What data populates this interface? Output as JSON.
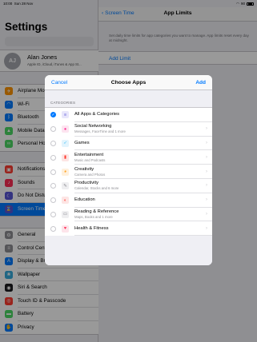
{
  "status_bar": {
    "time": "10:00",
    "date": "Sun 28 Nov",
    "battery": "90"
  },
  "sidebar": {
    "title": "Settings",
    "profile": {
      "initials": "AJ",
      "name": "Alan Jones",
      "subtitle": "Apple ID, iCloud, iTunes & App St..."
    },
    "groups": [
      [
        {
          "label": "Airplane Mode",
          "icon": "airplane-icon",
          "color": "#ff9500",
          "glyph": "✈"
        },
        {
          "label": "Wi-Fi",
          "icon": "wifi-icon",
          "color": "#007aff",
          "glyph": "◠"
        },
        {
          "label": "Bluetooth",
          "icon": "bluetooth-icon",
          "color": "#007aff",
          "glyph": "ᛒ"
        },
        {
          "label": "Mobile Data",
          "icon": "antenna-icon",
          "color": "#4cd964",
          "glyph": "▲"
        },
        {
          "label": "Personal Hotspot",
          "icon": "hotspot-icon",
          "color": "#4cd964",
          "glyph": "∞"
        }
      ],
      [
        {
          "label": "Notifications",
          "icon": "notifications-icon",
          "color": "#ff3b30",
          "glyph": "▣"
        },
        {
          "label": "Sounds",
          "icon": "speaker-icon",
          "color": "#ff2d55",
          "glyph": "♪"
        },
        {
          "label": "Do Not Disturb",
          "icon": "moon-icon",
          "color": "#5856d6",
          "glyph": "☾"
        },
        {
          "label": "Screen Time",
          "icon": "hourglass-icon",
          "color": "#5856d6",
          "glyph": "⌛",
          "selected": true
        }
      ],
      [
        {
          "label": "General",
          "icon": "gear-icon",
          "color": "#8e8e93",
          "glyph": "⚙"
        },
        {
          "label": "Control Centre",
          "icon": "switches-icon",
          "color": "#8e8e93",
          "glyph": "≡"
        },
        {
          "label": "Display & Brightness",
          "icon": "text-size-icon",
          "color": "#007aff",
          "glyph": "A"
        },
        {
          "label": "Wallpaper",
          "icon": "wallpaper-icon",
          "color": "#34aadc",
          "glyph": "❀"
        },
        {
          "label": "Siri & Search",
          "icon": "siri-icon",
          "color": "#1c1c1e",
          "glyph": "◉"
        },
        {
          "label": "Touch ID & Passcode",
          "icon": "fingerprint-icon",
          "color": "#ff3b30",
          "glyph": "◎"
        },
        {
          "label": "Battery",
          "icon": "battery-icon",
          "color": "#4cd964",
          "glyph": "▬"
        },
        {
          "label": "Privacy",
          "icon": "hand-icon",
          "color": "#007aff",
          "glyph": "✋"
        }
      ]
    ]
  },
  "detail": {
    "back_label": "Screen Time",
    "title": "App Limits",
    "footnote": "Set daily time limits for app categories you want to manage. App limits reset every day at midnight.",
    "add_limit": "Add Limit"
  },
  "modal": {
    "cancel": "Cancel",
    "title": "Choose Apps",
    "add": "Add",
    "section": "CATEGORIES",
    "items": [
      {
        "title": "All Apps & Categories",
        "subtitle": "",
        "icon": "stack-icon",
        "color": "#5856d6",
        "bg": "#e8e6fb",
        "glyph": "≡",
        "checked": true
      },
      {
        "title": "Social Networking",
        "subtitle": "Messages, FaceTime and 1 more",
        "icon": "speech-bubble-icon",
        "color": "#ff2d95",
        "bg": "#fde4f0",
        "glyph": "●"
      },
      {
        "title": "Games",
        "subtitle": "",
        "icon": "rocket-icon",
        "color": "#5ac8fa",
        "bg": "#e2f4fd",
        "glyph": "➶"
      },
      {
        "title": "Entertainment",
        "subtitle": "Music and Podcasts",
        "icon": "popcorn-icon",
        "color": "#ff3b30",
        "bg": "#fde5e4",
        "glyph": "▮"
      },
      {
        "title": "Creativity",
        "subtitle": "Camera and Photos",
        "icon": "palette-icon",
        "color": "#ff9500",
        "bg": "#fff0dc",
        "glyph": "◕"
      },
      {
        "title": "Productivity",
        "subtitle": "Calendar, Stocks and 6 more",
        "icon": "pencil-icon",
        "color": "#8e8e93",
        "bg": "#eeeef0",
        "glyph": "✎"
      },
      {
        "title": "Education",
        "subtitle": "",
        "icon": "globe-icon",
        "color": "#ff3b30",
        "bg": "#fde5e4",
        "glyph": "◐"
      },
      {
        "title": "Reading & Reference",
        "subtitle": "Maps, Books and 1 more",
        "icon": "book-icon",
        "color": "#8e8e93",
        "bg": "#eeeef0",
        "glyph": "▭"
      },
      {
        "title": "Health & Fitness",
        "subtitle": "",
        "icon": "heart-icon",
        "color": "#ff2d55",
        "bg": "#fde4ea",
        "glyph": "♥"
      }
    ]
  }
}
